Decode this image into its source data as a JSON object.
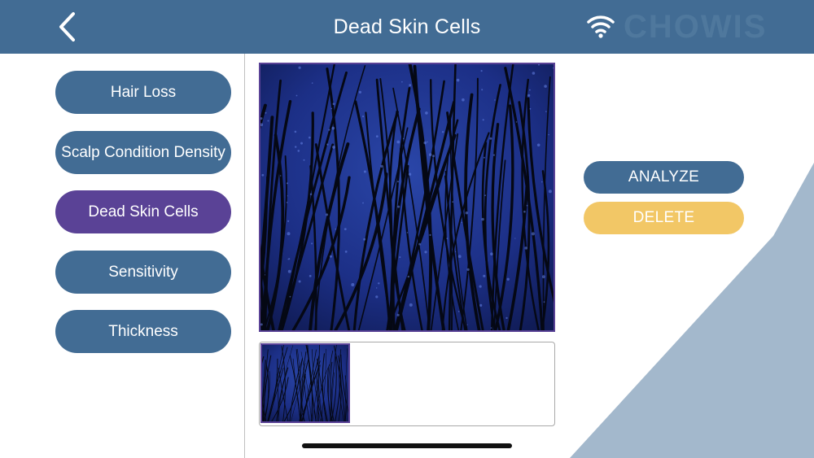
{
  "header": {
    "title": "Dead Skin Cells",
    "brand": "CHOWIS",
    "back_icon": "chevron-left-icon",
    "wifi_icon": "wifi-icon"
  },
  "sidebar": {
    "items": [
      {
        "label": "Hair Loss",
        "active": false
      },
      {
        "label": "Scalp Condition Density",
        "active": false
      },
      {
        "label": "Dead Skin Cells",
        "active": true
      },
      {
        "label": "Sensitivity",
        "active": false
      },
      {
        "label": "Thickness",
        "active": false
      }
    ]
  },
  "actions": {
    "analyze_label": "ANALYZE",
    "delete_label": "DELETE"
  },
  "colors": {
    "primary": "#426c94",
    "active": "#5a4296",
    "delete": "#f2c766",
    "triangle": "#a3b8cc"
  }
}
